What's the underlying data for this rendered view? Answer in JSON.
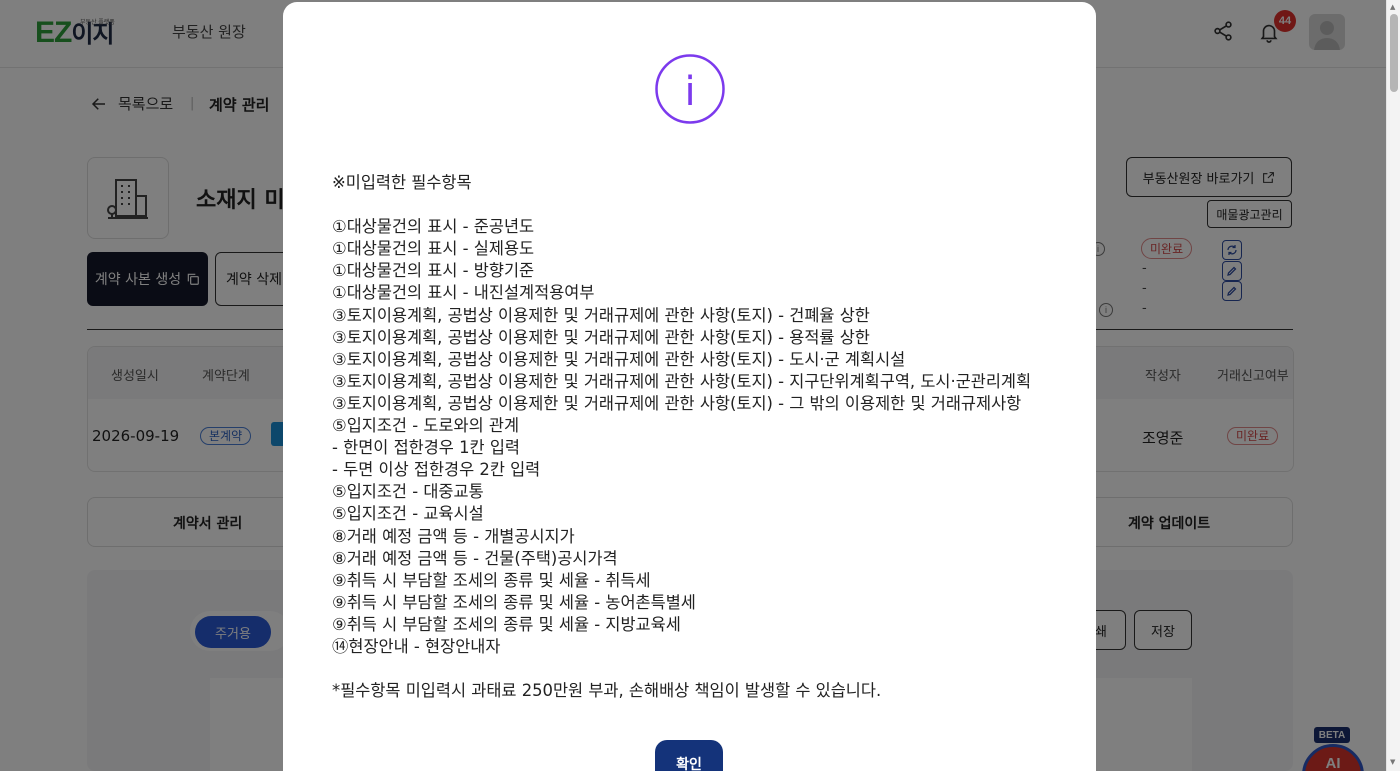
{
  "header": {
    "logo_main": "EZ",
    "logo_ko": "이지",
    "logo_sub": "부동산 플랫폼",
    "nav_label": "부동산 원장",
    "notifications_count": "44",
    "icons": [
      "share-icon",
      "bell-icon",
      "avatar-icon"
    ]
  },
  "breadcrumb": {
    "back_label": "목록으로",
    "separator": "|",
    "current": "계약 관리"
  },
  "property": {
    "title": "소재지 미"
  },
  "actions": {
    "copy_label": "계약 사본 생성",
    "delete_label": "계약 삭제"
  },
  "side": {
    "registry_link_label": "부동산원장 바로가기",
    "ad_manage_label": "매물광고관리",
    "status_badge": "미완료",
    "dash_values": [
      "-",
      "-",
      "-"
    ]
  },
  "table": {
    "headers": [
      "생성일시",
      "계약단계",
      "작성자",
      "거래신고여부"
    ],
    "row": {
      "date": "2026-09-19",
      "stage": "본계약",
      "author": "조영준",
      "report": "미완료"
    }
  },
  "tabs": {
    "left": "계약서 관리",
    "right": "계약 업데이트"
  },
  "editor": {
    "category_pill": "주거용",
    "print_label": "쇄",
    "save_label": "저장"
  },
  "ai": {
    "beta_label": "BETA",
    "button_label": "AI"
  },
  "modal": {
    "info_symbol": "i",
    "header_line": "※미입력한 필수항목",
    "items": [
      "①대상물건의 표시 - 준공년도",
      "①대상물건의 표시 - 실제용도",
      "①대상물건의 표시 - 방향기준",
      "①대상물건의 표시 - 내진설계적용여부",
      "③토지이용계획, 공법상 이용제한 및 거래규제에 관한 사항(토지) - 건폐율 상한",
      "③토지이용계획, 공법상 이용제한 및 거래규제에 관한 사항(토지) - 용적률 상한",
      "③토지이용계획, 공법상 이용제한 및 거래규제에 관한 사항(토지) - 도시·군 계획시설",
      "③토지이용계획, 공법상 이용제한 및 거래규제에 관한 사항(토지) - 지구단위계획구역, 도시·군관리계획",
      "③토지이용계획, 공법상 이용제한 및 거래규제에 관한 사항(토지) - 그 밖의 이용제한 및 거래규제사항",
      "⑤입지조건 - 도로와의 관계",
      "- 한면이 접한경우 1칸 입력",
      "- 두면 이상 접한경우 2칸 입력",
      "⑤입지조건 - 대중교통",
      "⑤입지조건 - 교육시설",
      "⑧거래 예정 금액 등 - 개별공시지가",
      "⑧거래 예정 금액 등 - 건물(주택)공시가격",
      "⑨취득 시 부담할 조세의 종류 및 세율 - 취득세",
      "⑨취득 시 부담할 조세의 종류 및 세율 - 농어촌특별세",
      "⑨취득 시 부담할 조세의 종류 및 세율 - 지방교육세",
      "⑭현장안내 - 현장안내자"
    ],
    "footer_note": "*필수항목 미입력시 과태료 250만원 부과, 손해배상 책임이 발생할 수 있습니다.",
    "confirm_label": "확인",
    "accent_color": "#7c3aed",
    "button_color": "#14337a"
  }
}
